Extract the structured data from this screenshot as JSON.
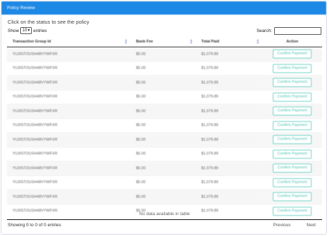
{
  "panel": {
    "title": "Policy Review"
  },
  "subtitle": "Click on the status to see the policy",
  "length_control": {
    "prefix": "Show",
    "value": "10",
    "suffix": "entries"
  },
  "search": {
    "label": "Search:",
    "value": ""
  },
  "table": {
    "columns": [
      "Transaction Group Id",
      "Bank Fee",
      "Total Paid",
      "Action"
    ],
    "rows": [
      [
        "YU3ISTOUSH48VYWFXR",
        "$5.00",
        "$1,079.89",
        "Confirm Payment"
      ],
      [
        "YU3ISTOUSH48VYWFXR",
        "$5.00",
        "$1,079.89",
        "Confirm Payment"
      ],
      [
        "YU3ISTOUSH48VYWFXR",
        "$5.00",
        "$1,079.89",
        "Confirm Payment"
      ],
      [
        "YU3ISTOUSH48VYWFXR",
        "$5.00",
        "$1,079.89",
        "Confirm Payment"
      ],
      [
        "YU3ISTOUSH48VYWFXR",
        "$5.00",
        "$1,079.89",
        "Confirm Payment"
      ],
      [
        "YU3ISTOUSH48VYWFXR",
        "$5.00",
        "$1,079.89",
        "Confirm Payment"
      ],
      [
        "YU3ISTOUSH48VYWFXR",
        "$5.00",
        "$1,079.89",
        "Confirm Payment"
      ],
      [
        "YU3ISTOUSH48VYWFXR",
        "$5.00",
        "$1,079.89",
        "Confirm Payment"
      ],
      [
        "YU3ISTOUSH48VYWFXR",
        "$5.00",
        "$1,079.89",
        "Confirm Payment"
      ],
      [
        "YU3ISTOUSH48VYWFXR",
        "$5.00",
        "$1,079.89",
        "Confirm Payment"
      ],
      [
        "YU3ISTOUSH48VYWFXR",
        "$5.00",
        "$1,079.89",
        "Confirm Payment"
      ],
      [
        "YU3ISTOUSH48VYWFXR",
        "$5.00",
        "$1,079.89",
        "Confirm Payment"
      ]
    ],
    "empty_message": "No data available in table"
  },
  "footer": {
    "info": "Showing 0 to 0 of 0 entries",
    "previous": "Previous",
    "next": "Next"
  },
  "colors": {
    "header_bg": "#1e88e5",
    "button_accent": "#4fc3b5"
  },
  "icons": {
    "sort": "sort-arrows-icon",
    "dropdown": "chevron-down-icon"
  }
}
